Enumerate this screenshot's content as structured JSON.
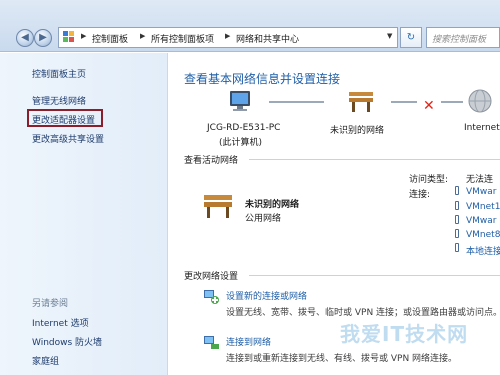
{
  "address_bar": {
    "back_glyph": "◀",
    "forward_glyph": "▶",
    "breadcrumbs": [
      "控制面板",
      "所有控制面板项",
      "网络和共享中心"
    ],
    "refresh_glyph": "↻",
    "search_placeholder": "搜索控制面板"
  },
  "sidebar": {
    "home": "控制面板主页",
    "items": [
      "管理无线网络",
      "更改适配器设置",
      "更改高级共享设置"
    ],
    "see_also_heading": "另请参阅",
    "see_also": [
      "Internet 选项",
      "Windows 防火墙",
      "家庭组"
    ]
  },
  "main": {
    "title": "查看基本网络信息并设置连接",
    "map": {
      "computer_name": "JCG-RD-E531-PC",
      "computer_sub": "(此计算机)",
      "network_name": "未识别的网络",
      "internet_label": "Internet"
    },
    "active_networks_heading": "查看活动网络",
    "active_network": {
      "name": "未识别的网络",
      "type": "公用网络",
      "access_type_label": "访问类型:",
      "access_type_value": "无法连",
      "connections_label": "连接:",
      "connections": [
        "VMwar",
        "VMnet1",
        "VMwar",
        "VMnet8",
        "本地连接"
      ]
    },
    "change_settings_heading": "更改网络设置",
    "tasks": [
      {
        "title": "设置新的连接或网络",
        "desc": "设置无线、宽带、拨号、临时或 VPN 连接；或设置路由器或访问点。"
      },
      {
        "title": "连接到网络",
        "desc": "连接到或重新连接到无线、有线、拨号或 VPN 网络连接。"
      }
    ]
  },
  "watermark": "我爱IT技术网",
  "colors": {
    "link": "#1f5fa8",
    "sidebar_bg": "#e2edf9",
    "highlight_border": "#8b1e2b",
    "disconnect_x": "#e0261b"
  }
}
